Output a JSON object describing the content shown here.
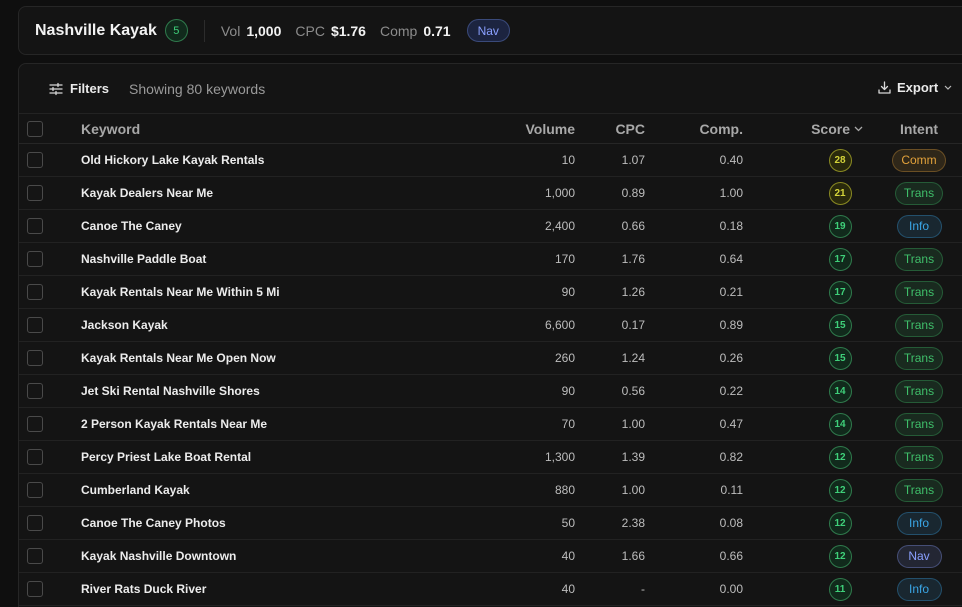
{
  "header": {
    "keyword": "Nashville Kayak",
    "score": "5",
    "vol_label": "Vol",
    "vol_value": "1,000",
    "cpc_label": "CPC",
    "cpc_value": "$1.76",
    "comp_label": "Comp",
    "comp_value": "0.71",
    "intent": "Nav"
  },
  "toolbar": {
    "filters_label": "Filters",
    "showing_text": "Showing 80 keywords",
    "export_label": "Export"
  },
  "columns": {
    "keyword": "Keyword",
    "volume": "Volume",
    "cpc": "CPC",
    "comp": "Comp.",
    "score": "Score",
    "intent": "Intent"
  },
  "colors": {
    "score_high_border": "#8a8a22",
    "score_high_bg": "#2a2a0c",
    "score_high_text": "#d4d43a",
    "score_low_border": "#2f7a4c",
    "score_low_bg": "#112a1c",
    "score_low_text": "#3fd07a",
    "comm": "#e3a23b",
    "trans": "#3fbf6a",
    "info": "#3aa6e6",
    "nav": "#8aa0ff"
  },
  "rows": [
    {
      "keyword": "Old Hickory Lake Kayak Rentals",
      "volume": "10",
      "cpc": "1.07",
      "comp": "0.40",
      "score": "28",
      "intent": "Comm"
    },
    {
      "keyword": "Kayak Dealers Near Me",
      "volume": "1,000",
      "cpc": "0.89",
      "comp": "1.00",
      "score": "21",
      "intent": "Trans"
    },
    {
      "keyword": "Canoe The Caney",
      "volume": "2,400",
      "cpc": "0.66",
      "comp": "0.18",
      "score": "19",
      "intent": "Info"
    },
    {
      "keyword": "Nashville Paddle Boat",
      "volume": "170",
      "cpc": "1.76",
      "comp": "0.64",
      "score": "17",
      "intent": "Trans"
    },
    {
      "keyword": "Kayak Rentals Near Me Within 5 Mi",
      "volume": "90",
      "cpc": "1.26",
      "comp": "0.21",
      "score": "17",
      "intent": "Trans"
    },
    {
      "keyword": "Jackson Kayak",
      "volume": "6,600",
      "cpc": "0.17",
      "comp": "0.89",
      "score": "15",
      "intent": "Trans"
    },
    {
      "keyword": "Kayak Rentals Near Me Open Now",
      "volume": "260",
      "cpc": "1.24",
      "comp": "0.26",
      "score": "15",
      "intent": "Trans"
    },
    {
      "keyword": "Jet Ski Rental Nashville Shores",
      "volume": "90",
      "cpc": "0.56",
      "comp": "0.22",
      "score": "14",
      "intent": "Trans"
    },
    {
      "keyword": "2 Person Kayak Rentals Near Me",
      "volume": "70",
      "cpc": "1.00",
      "comp": "0.47",
      "score": "14",
      "intent": "Trans"
    },
    {
      "keyword": "Percy Priest Lake Boat Rental",
      "volume": "1,300",
      "cpc": "1.39",
      "comp": "0.82",
      "score": "12",
      "intent": "Trans"
    },
    {
      "keyword": "Cumberland Kayak",
      "volume": "880",
      "cpc": "1.00",
      "comp": "0.11",
      "score": "12",
      "intent": "Trans"
    },
    {
      "keyword": "Canoe The Caney Photos",
      "volume": "50",
      "cpc": "2.38",
      "comp": "0.08",
      "score": "12",
      "intent": "Info"
    },
    {
      "keyword": "Kayak Nashville Downtown",
      "volume": "40",
      "cpc": "1.66",
      "comp": "0.66",
      "score": "12",
      "intent": "Nav"
    },
    {
      "keyword": "River Rats Duck River",
      "volume": "40",
      "cpc": "-",
      "comp": "0.00",
      "score": "11",
      "intent": "Info"
    }
  ]
}
